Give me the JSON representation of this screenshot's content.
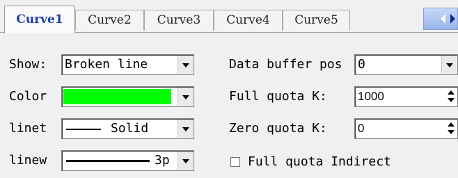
{
  "tabs": [
    {
      "label": "Curve1",
      "active": true
    },
    {
      "label": "Curve2",
      "active": false
    },
    {
      "label": "Curve3",
      "active": false
    },
    {
      "label": "Curve4",
      "active": false
    },
    {
      "label": "Curve5",
      "active": false
    }
  ],
  "left": {
    "show": {
      "label": "Show:",
      "value": "Broken line"
    },
    "color": {
      "label": "Color",
      "value": "#00ff00"
    },
    "linetype": {
      "label": "linet",
      "value": "Solid"
    },
    "linewidth": {
      "label": "linew",
      "value": "3p"
    }
  },
  "right": {
    "data_buffer_pos": {
      "label": "Data buffer pos",
      "value": "0"
    },
    "full_quota_k": {
      "label": "Full quota K:",
      "value": "1000"
    },
    "zero_quota_k": {
      "label": "Zero quota K:",
      "value": "0"
    },
    "full_quota_indirect": {
      "label": "Full quota Indirect",
      "checked": false
    }
  },
  "icons": {
    "tab_scroll_left": "arrow-left-icon",
    "tab_scroll_right": "arrow-right-icon",
    "dropdown": "chevron-down-icon",
    "spin_up": "spin-up-icon",
    "spin_down": "spin-down-icon"
  },
  "colors": {
    "active_tab_text": "#1d3fa6",
    "color_swatch": "#00ff00"
  }
}
